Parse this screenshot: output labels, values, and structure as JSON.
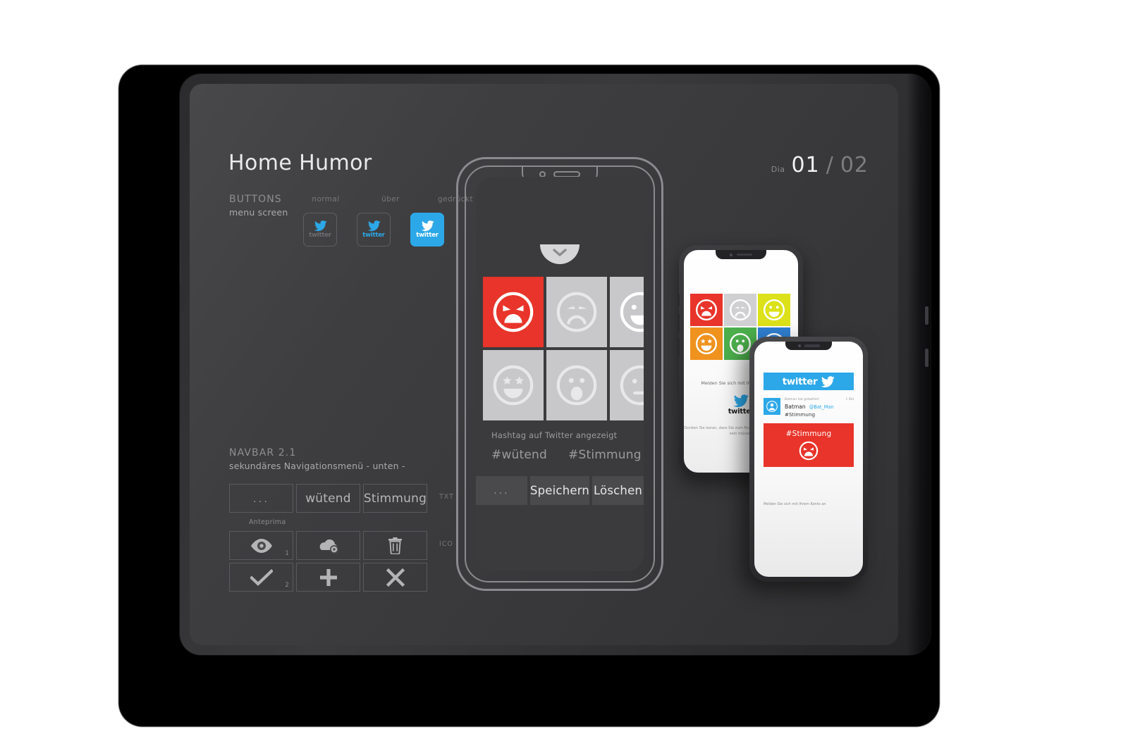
{
  "header": {
    "title": "Home Humor",
    "slide_label": "Dia",
    "slide_current": "01",
    "slide_separator": "/",
    "slide_total": "02"
  },
  "sections": {
    "buttons": {
      "heading": "BUTTONS",
      "subheading": "menu screen",
      "state_labels": [
        "normal",
        "über",
        "gedrückt"
      ],
      "button_word": "twitter",
      "accent_color": "#2CA8E8"
    },
    "navbar": {
      "heading": "NAVBAR 2.1",
      "subheading": "sekundäres Navigationsmenü - unten -",
      "preview_label": "Anteprima",
      "row_tag_text": "TXT",
      "row_tag_icon": "ICO",
      "text_row": [
        "...",
        "wütend",
        "Stimmung"
      ],
      "icon_row_1": [
        "eye-icon",
        "cloud-upload-icon",
        "trash-icon"
      ],
      "icon_row_2": [
        "check-icon",
        "plus-icon",
        "close-icon"
      ],
      "icon_row_1_number": "1",
      "icon_row_2_number": "2"
    }
  },
  "main_phone": {
    "pull_tab_icon": "chevron-down-icon",
    "emoji_grid": [
      {
        "name": "angry-face",
        "selected": true
      },
      {
        "name": "sad-face",
        "selected": false
      },
      {
        "name": "happy-face",
        "selected": false
      },
      {
        "name": "star-eyes-face",
        "selected": false
      },
      {
        "name": "surprised-face",
        "selected": false
      },
      {
        "name": "neutral-face",
        "selected": false
      }
    ],
    "hashtag_caption": "Hashtag auf Twitter angezeigt",
    "hashtags": [
      "#wütend",
      "#Stimmung"
    ],
    "bottom_bar": [
      "...",
      "Speichern",
      "Löschen"
    ],
    "colors": {
      "selected_tile": "#E8342A",
      "tile": "#c8c8ca",
      "screen": "#3b3b3d"
    }
  },
  "mid_phone": {
    "tiles": [
      {
        "name": "angry-face",
        "color": "#E8342A"
      },
      {
        "name": "sad-face",
        "color": "#D0D0D2"
      },
      {
        "name": "happy-face",
        "color": "#DCE119"
      },
      {
        "name": "star-eyes-face",
        "color": "#F0921E"
      },
      {
        "name": "surprised-face",
        "color": "#4CAF4C"
      },
      {
        "name": "smile-face",
        "color": "#2F7FD1"
      }
    ],
    "login_text": "Melden Sie sich mit Ihrem Konto an",
    "twitter_word": "twitter",
    "footer_text": "Denken Sie daran, dass Sie zum Posten mit Twitter verbunden sein müssen"
  },
  "front_phone": {
    "twitter_word": "twitter",
    "retweet_note": "Batman hat getwittert",
    "time": "1 Std",
    "user_name": "Batman",
    "user_handle": "@Bat_Man",
    "tweet_text": "#Stimmung",
    "tile_label": "#Stimmung",
    "tile_face": "angry-face",
    "tile_color": "#E8342A",
    "footer_text": "Melden Sie sich mit Ihrem Konto an"
  }
}
